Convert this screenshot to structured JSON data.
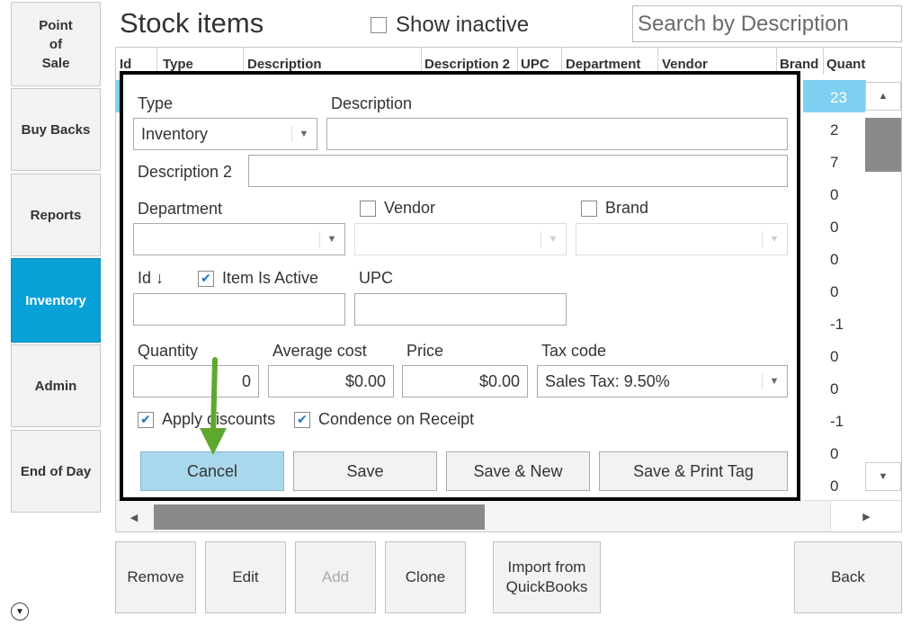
{
  "nav": {
    "items": [
      {
        "label": "Point\nof\nSale",
        "active": false
      },
      {
        "label": "Buy Backs",
        "active": false
      },
      {
        "label": "Reports",
        "active": false
      },
      {
        "label": "Inventory",
        "active": true
      },
      {
        "label": "Admin",
        "active": false
      },
      {
        "label": "End of Day",
        "active": false
      }
    ]
  },
  "header": {
    "title": "Stock items",
    "show_inactive_label": "Show inactive",
    "search_placeholder": "Search by Description"
  },
  "grid": {
    "columns": [
      "Id",
      "Type",
      "Description",
      "Description 2",
      "UPC",
      "Department",
      "Vendor",
      "Brand",
      "Quant"
    ],
    "quantities": [
      "23",
      "2",
      "7",
      "0",
      "0",
      "0",
      "0",
      "-1",
      "0",
      "0",
      "-1",
      "0",
      "0"
    ]
  },
  "dialog": {
    "type_label": "Type",
    "type_value": "Inventory",
    "description_label": "Description",
    "description_value": "",
    "description2_label": "Description 2",
    "description2_value": "",
    "department_label": "Department",
    "vendor_label": "Vendor",
    "brand_label": "Brand",
    "id_label": "Id ↓",
    "item_active_label": "Item Is Active",
    "upc_label": "UPC",
    "quantity_label": "Quantity",
    "quantity_value": "0",
    "avg_cost_label": "Average cost",
    "avg_cost_value": "$0.00",
    "price_label": "Price",
    "price_value": "$0.00",
    "tax_code_label": "Tax code",
    "tax_code_value": "Sales Tax: 9.50%",
    "apply_discounts_label": "Apply discounts",
    "condence_label": "Condence on Receipt",
    "buttons": {
      "cancel": "Cancel",
      "save": "Save",
      "save_new": "Save & New",
      "save_print": "Save & Print Tag"
    }
  },
  "bottom": {
    "remove": "Remove",
    "edit": "Edit",
    "add": "Add",
    "clone": "Clone",
    "import": "Import from\nQuickBooks",
    "back": "Back"
  },
  "colors": {
    "accent": "#0aa0d8",
    "selection": "#7fd0f0",
    "cancel_button": "#a9d8ec",
    "annotation_arrow": "#5fa82e"
  }
}
